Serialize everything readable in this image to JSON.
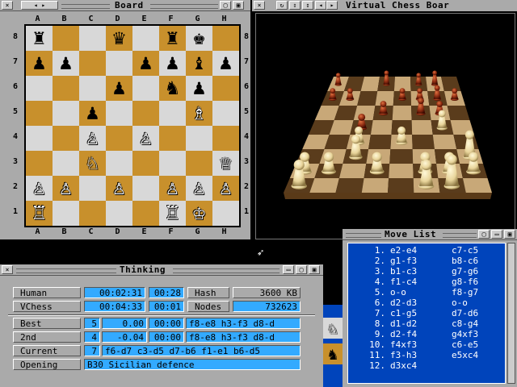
{
  "board_window": {
    "title": "Board",
    "files": [
      "A",
      "B",
      "C",
      "D",
      "E",
      "F",
      "G",
      "H"
    ],
    "ranks": [
      "8",
      "7",
      "6",
      "5",
      "4",
      "3",
      "2",
      "1"
    ],
    "squares": [
      [
        "♜",
        "",
        "",
        "♛",
        "",
        "♜",
        "♚",
        ""
      ],
      [
        "♟",
        "♟",
        "",
        "",
        "♟",
        "♟",
        "♝",
        "♟"
      ],
      [
        "",
        "",
        "",
        "♟",
        "",
        "♞",
        "♟",
        ""
      ],
      [
        "",
        "",
        "♟",
        "",
        "",
        "",
        "♗",
        ""
      ],
      [
        "",
        "",
        "♙",
        "",
        "♙",
        "",
        "",
        ""
      ],
      [
        "",
        "",
        "♘",
        "",
        "",
        "",
        "",
        "♕"
      ],
      [
        "♙",
        "♙",
        "",
        "♙",
        "",
        "♙",
        "♙",
        "♙"
      ],
      [
        "♖",
        "",
        "",
        "",
        "",
        "♖",
        "♔",
        ""
      ]
    ],
    "colors": [
      [
        "b",
        "",
        "",
        "b",
        "",
        "b",
        "b",
        ""
      ],
      [
        "b",
        "b",
        "",
        "",
        "b",
        "b",
        "b",
        "b"
      ],
      [
        "",
        "",
        "",
        "b",
        "",
        "b",
        "b",
        ""
      ],
      [
        "",
        "",
        "b",
        "",
        "",
        "",
        "w",
        ""
      ],
      [
        "",
        "",
        "w",
        "",
        "w",
        "",
        "",
        ""
      ],
      [
        "",
        "",
        "w",
        "",
        "",
        "",
        "",
        "w"
      ],
      [
        "w",
        "w",
        "",
        "w",
        "",
        "w",
        "w",
        "w"
      ],
      [
        "w",
        "",
        "",
        "",
        "",
        "w",
        "w",
        ""
      ]
    ],
    "light_color": "#d8d8d8",
    "dark_color": "#c8902c"
  },
  "view3d_window": {
    "title": "Virtual Chess Boar"
  },
  "moves_window": {
    "title": "Move List",
    "moves": [
      {
        "n": "1.",
        "w": "e2-e4",
        "b": "c7-c5"
      },
      {
        "n": "2.",
        "w": "g1-f3",
        "b": "b8-c6"
      },
      {
        "n": "3.",
        "w": "b1-c3",
        "b": "g7-g6"
      },
      {
        "n": "4.",
        "w": "f1-c4",
        "b": "g8-f6"
      },
      {
        "n": "5.",
        "w": "o-o",
        "b": "f8-g7"
      },
      {
        "n": "6.",
        "w": "d2-d3",
        "b": "o-o"
      },
      {
        "n": "7.",
        "w": "c1-g5",
        "b": "d7-d6"
      },
      {
        "n": "8.",
        "w": "d1-d2",
        "b": "c8-g4"
      },
      {
        "n": "9.",
        "w": "d2-f4",
        "b": "g4xf3"
      },
      {
        "n": "10.",
        "w": "f4xf3",
        "b": "c6-e5"
      },
      {
        "n": "11.",
        "w": "f3-h3",
        "b": "e5xc4"
      },
      {
        "n": "12.",
        "w": "d3xc4",
        "b": ""
      }
    ]
  },
  "thinking_window": {
    "title": "Thinking",
    "human_label": "Human",
    "human_time": "00:02:31",
    "human_move_time": "00:28",
    "hash_label": "Hash",
    "hash_value": "3600 KB",
    "vchess_label": "VChess",
    "vchess_time": "00:04:33",
    "vchess_move_time": "00:01",
    "nodes_label": "Nodes",
    "nodes_value": "732623",
    "best_label": "Best",
    "best_depth": "5",
    "best_score": "0.00",
    "best_time": "00:00",
    "best_line": "f8-e8 h3-f3 d8-d",
    "second_label": "2nd",
    "second_depth": "4",
    "second_score": "-0.04",
    "second_time": "00:00",
    "second_line": "f8-e8 h3-f3 d8-d",
    "current_label": "Current",
    "current_depth": "7",
    "current_line": "f6-d7 c3-d5 d7-b6 f1-e1 b6-d5",
    "opening_label": "Opening",
    "opening_value": "B30 Sicilian defence"
  }
}
